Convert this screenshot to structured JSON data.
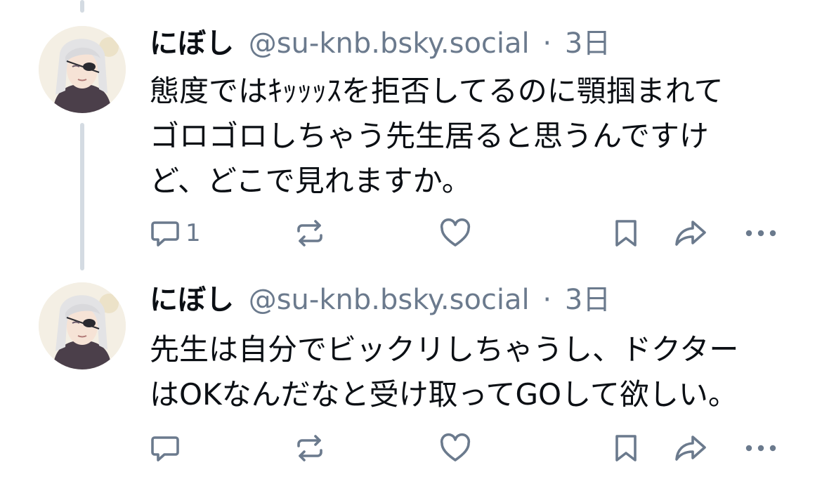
{
  "posts": [
    {
      "author_name": "にぼし",
      "handle": "@su-knb.bsky.social",
      "separator": "·",
      "time": "3日",
      "text_lines": [
        "態度ではｷｯｯｯｽを拒否してるのに顎掴まれて",
        "ゴロゴロしちゃう先生居ると思うんですけ",
        "ど、どこで見れますか。"
      ],
      "reply_count": "1",
      "icons": [
        "reply-icon",
        "repost-icon",
        "like-icon",
        "bookmark-icon",
        "share-icon",
        "more-icon"
      ]
    },
    {
      "author_name": "にぼし",
      "handle": "@su-knb.bsky.social",
      "separator": "·",
      "time": "3日",
      "text_lines": [
        "先生は自分でビックリしちゃうし、ドクター",
        "はOKなんだなと受け取ってGOして欲しい。"
      ],
      "reply_count": "",
      "icons": [
        "reply-icon",
        "repost-icon",
        "like-icon",
        "bookmark-icon",
        "share-icon",
        "more-icon"
      ]
    }
  ],
  "colors": {
    "text": "#0b0f14",
    "muted": "#6b7a8d",
    "thread_line": "#d4dbe2"
  }
}
